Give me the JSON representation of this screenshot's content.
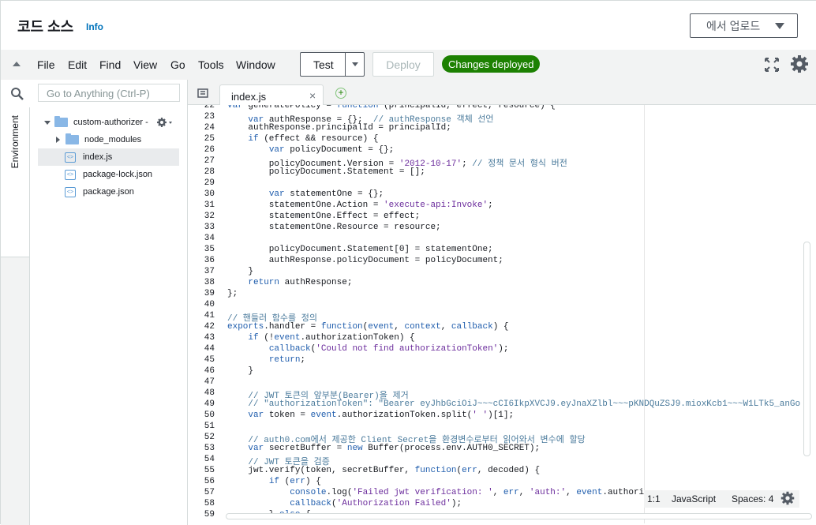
{
  "header": {
    "title": "코드 소스",
    "info_link": "Info",
    "upload_button": "에서 업로드"
  },
  "menubar": {
    "items": [
      "File",
      "Edit",
      "Find",
      "View",
      "Go",
      "Tools",
      "Window"
    ],
    "test_button": "Test",
    "deploy_button": "Deploy",
    "status_badge": "Changes deployed"
  },
  "tree": {
    "search_placeholder": "Go to Anything (Ctrl-P)",
    "environment_tab": "Environment",
    "nodes": [
      {
        "label": "custom-authorizer -",
        "type": "folder-open"
      },
      {
        "label": "node_modules",
        "type": "folder-closed"
      },
      {
        "label": "index.js",
        "type": "file",
        "selected": true
      },
      {
        "label": "package-lock.json",
        "type": "file"
      },
      {
        "label": "package.json",
        "type": "file"
      }
    ]
  },
  "editor": {
    "tab_name": "index.js",
    "first_line": 22,
    "lines": [
      "var generatePolicy = function (principalId, effect, resource) {",
      "    var authResponse = {};  // authResponse 객체 선언",
      "    authResponse.principalId = principalId;",
      "    if (effect && resource) {",
      "        var policyDocument = {};",
      "        policyDocument.Version = '2012-10-17'; // 정책 문서 형식 버전",
      "        policyDocument.Statement = [];",
      "",
      "        var statementOne = {};",
      "        statementOne.Action = 'execute-api:Invoke';",
      "        statementOne.Effect = effect;",
      "        statementOne.Resource = resource;",
      "",
      "        policyDocument.Statement[0] = statementOne;",
      "        authResponse.policyDocument = policyDocument;",
      "    }",
      "    return authResponse;",
      "};",
      "",
      "// 핸들러 함수를 정의",
      "exports.handler = function(event, context, callback) {",
      "    if (!event.authorizationToken) {",
      "        callback('Could not find authorizationToken');",
      "        return;",
      "    }",
      "",
      "    // JWT 토큰의 앞부분(Bearer)을 제거",
      "    // \"authorizationToken\": \"Bearer eyJhbGciOiJ~~~cCI6IkpXVCJ9.eyJnaXZlbl~~~pKNDQuZSJ9.mioxKcb1~~~W1LTk5_anGo",
      "    var token = event.authorizationToken.split(' ')[1];",
      "",
      "    // auth0.com에서 제공한 Client Secret을 환경변수로부터 읽어와서 변수에 할당",
      "    var secretBuffer = new Buffer(process.env.AUTH0_SECRET);",
      "    // JWT 토큰을 검증",
      "    jwt.verify(token, secretBuffer, function(err, decoded) {",
      "        if (err) {",
      "            console.log('Failed jwt verification: ', err, 'auth:', event.authori",
      "            callback('Authorization Failed');",
      "        } else {"
    ]
  },
  "statusbar": {
    "position": "1:1",
    "language": "JavaScript",
    "indent": "Spaces: 4"
  }
}
